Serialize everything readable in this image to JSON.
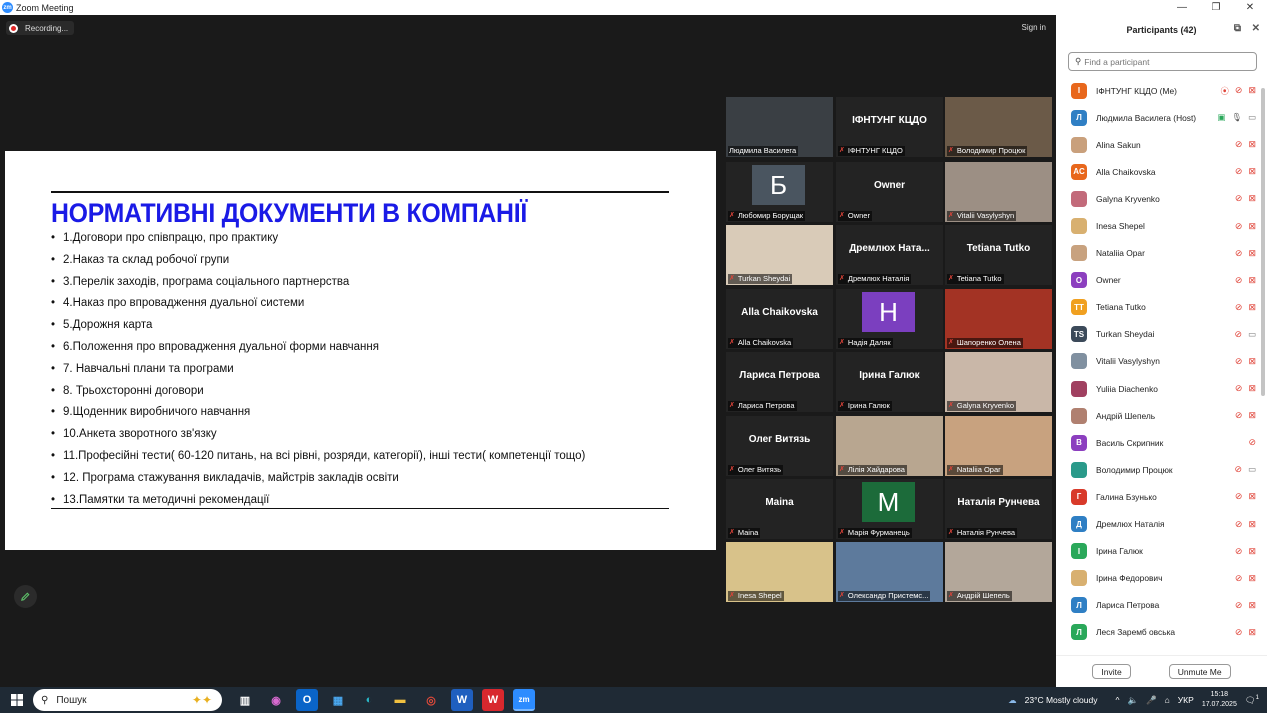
{
  "window": {
    "title": "Zoom Meeting",
    "app_icon": "zm"
  },
  "meeting": {
    "recording_label": "Recording...",
    "signin_label": "Sign in"
  },
  "slide": {
    "title": "НОРМАТИВНІ ДОКУМЕНТИ В КОМПАНІЇ",
    "items": [
      "1.Договори про співпрацю, про практику",
      "2.Наказ та склад робочої групи",
      "3.Перелік заходів, програма соціального партнерства",
      "4.Наказ про впровадження дуальної системи",
      "5.Дорожня карта",
      "6.Положення про впровадження дуальної форми навчання",
      "7. Навчальні плани  та програми",
      "8. Трьохсторонні договори",
      "9.Щоденник виробничого навчання",
      "10.Анкета зворотного зв'язку",
      "11.Професійні тести( 60-120 питань, на всі рівні, розряди, категорії),  інші тести( компетенції тощо)",
      "12. Програма стажування викладачів, майстрів закладів освіти",
      "13.Памятки та методичні рекомендації"
    ]
  },
  "gallery": [
    {
      "label": "Людмила Василега",
      "display": "",
      "kind": "photo",
      "color": "#3a3f44",
      "active": true
    },
    {
      "label": "ІФНТУНГ КЦДО",
      "display": "ІФНТУНГ КЦДО",
      "kind": "name"
    },
    {
      "label": "Володимир Процюк",
      "display": "",
      "kind": "photo",
      "color": "#6b5a48"
    },
    {
      "label": "Любомир Борущак",
      "display": "Б",
      "kind": "avatar",
      "color": "#4a5560"
    },
    {
      "label": "Owner",
      "display": "Owner",
      "kind": "name"
    },
    {
      "label": "Vitalii Vasylyshyn",
      "display": "",
      "kind": "photo",
      "color": "#9c8f84"
    },
    {
      "label": "Turkan Sheydai",
      "display": "",
      "kind": "photo",
      "color": "#d9cbb8"
    },
    {
      "label": "Дремлюх Наталія",
      "display": "Дремлюх  Ната...",
      "kind": "name"
    },
    {
      "label": "Tetiana Tutko",
      "display": "Tetiana Tutko",
      "kind": "name"
    },
    {
      "label": "Alla Chaikovska",
      "display": "Alla Chaikovska",
      "kind": "name"
    },
    {
      "label": "Надія Даляк",
      "display": "H",
      "kind": "avatar",
      "color": "#7b3fbf"
    },
    {
      "label": "Шапоренко Олена",
      "display": "",
      "kind": "photo",
      "color": "#a33324"
    },
    {
      "label": "Лариса Петрова",
      "display": "Лариса Петрова",
      "kind": "name"
    },
    {
      "label": "Ірина Галюк",
      "display": "Ірина Галюк",
      "kind": "name"
    },
    {
      "label": "Galyna Kryvenko",
      "display": "",
      "kind": "photo",
      "color": "#c9b7a8"
    },
    {
      "label": "Олег Витязь",
      "display": "Олег Витязь",
      "kind": "name"
    },
    {
      "label": "Лілія Хайдарова",
      "display": "",
      "kind": "photo",
      "color": "#b8a690"
    },
    {
      "label": "Nataliia Opar",
      "display": "",
      "kind": "photo",
      "color": "#c8a27f"
    },
    {
      "label": "Maina",
      "display": "Maina",
      "kind": "name"
    },
    {
      "label": "Марія Фурманець",
      "display": "M",
      "kind": "avatar",
      "color": "#1c6b3a"
    },
    {
      "label": "Наталія Рунчева",
      "display": "Наталія Рунчева",
      "kind": "name"
    },
    {
      "label": "Inesa Shepel",
      "display": "",
      "kind": "photo",
      "color": "#d8c28a"
    },
    {
      "label": "Олександр Пристемс...",
      "display": "",
      "kind": "photo",
      "color": "#5d7a9c"
    },
    {
      "label": "Андрій Шепель",
      "display": "",
      "kind": "photo",
      "color": "#b3a79a"
    }
  ],
  "participants": {
    "title": "Participants (42)",
    "search_placeholder": "Find a participant",
    "list": [
      {
        "initials": "І",
        "name": "ІФНТУНГ КЦДО (Me)",
        "color": "#e8671c",
        "rec": true,
        "cam": "off"
      },
      {
        "initials": "Л",
        "name": "Людмила Василега (Host)",
        "color": "#2f7fc4",
        "share": true,
        "mic": "on",
        "cam": "on"
      },
      {
        "initials": "",
        "name": "Alina Sakun",
        "color": "#c9a07c",
        "cam": "off"
      },
      {
        "initials": "AC",
        "name": "Alla Chaikovska",
        "color": "#e8671c",
        "cam": "off"
      },
      {
        "initials": "",
        "name": "Galyna Kryvenko",
        "color": "#c26a7a",
        "cam": "off"
      },
      {
        "initials": "",
        "name": "Inesa Shepel",
        "color": "#d8b070",
        "cam": "off"
      },
      {
        "initials": "",
        "name": "Nataliia Opar",
        "color": "#c8a27f",
        "cam": "off"
      },
      {
        "initials": "O",
        "name": "Owner",
        "color": "#8c3fbf",
        "cam": "off"
      },
      {
        "initials": "TT",
        "name": "Tetiana Tutko",
        "color": "#f0a020",
        "cam": "off"
      },
      {
        "initials": "TS",
        "name": "Turkan Sheydai",
        "color": "#3c4a5a",
        "cam": "on-gray"
      },
      {
        "initials": "",
        "name": "Vitalii Vasylyshyn",
        "color": "#8090a0",
        "cam": "off"
      },
      {
        "initials": "",
        "name": "Yuliia Diachenko",
        "color": "#a04060",
        "cam": "off"
      },
      {
        "initials": "",
        "name": "Андрій Шепель",
        "color": "#b08070",
        "cam": "off"
      },
      {
        "initials": "В",
        "name": "Василь Скрипник",
        "color": "#8c3fbf",
        "cam": "none"
      },
      {
        "initials": "",
        "name": "Володимир Процюк",
        "color": "#2a9a8a",
        "cam": "on-gray"
      },
      {
        "initials": "Г",
        "name": "Галина Бзунько",
        "color": "#d83a2a",
        "cam": "off"
      },
      {
        "initials": "Д",
        "name": "Дремлюх Наталія",
        "color": "#2f7fc4",
        "cam": "off"
      },
      {
        "initials": "І",
        "name": "Ірина Галюк",
        "color": "#2aa85a",
        "cam": "off"
      },
      {
        "initials": "",
        "name": "Ірина Федорович",
        "color": "#d8b070",
        "cam": "off"
      },
      {
        "initials": "Л",
        "name": "Лариса Петрова",
        "color": "#2f7fc4",
        "cam": "off"
      },
      {
        "initials": "Л",
        "name": "Леся Заремб овська",
        "color": "#2aa85a",
        "cam": "off"
      }
    ],
    "invite_label": "Invite",
    "unmute_label": "Unmute Me"
  },
  "taskbar": {
    "search_label": "Пошук",
    "weather": "23°C  Mostly cloudy",
    "lang": "УКР",
    "time": "15:18",
    "date": "17.07.2025",
    "notif_count": "1"
  }
}
